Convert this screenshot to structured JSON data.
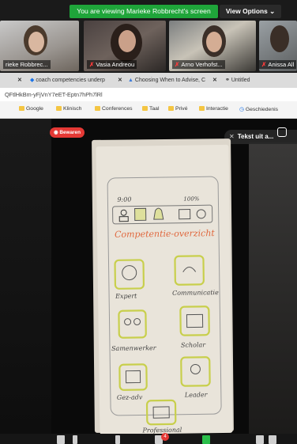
{
  "banner": {
    "viewing_text": "You are viewing Marieke Robbrecht's screen",
    "view_options_label": "View Options ⌄"
  },
  "participants": [
    {
      "name": "rieke Robbrec..."
    },
    {
      "name": "Vasia Andreou"
    },
    {
      "name": "Arno Verhofst..."
    },
    {
      "name": "Anissa All"
    }
  ],
  "browser": {
    "tabs": [
      {
        "label": "coach competencies underp"
      },
      {
        "label": "Choosing When to Advise, C"
      },
      {
        "label": "Untitled"
      }
    ],
    "address": "QFtlHkBm-yFjVnY7eET-Eptn7hPh7lRl",
    "bookmarks": [
      "Google",
      "Klinisch",
      "Conferences",
      "Taal",
      "Privé",
      "Interactie",
      "Geschiedenis"
    ]
  },
  "shared_view": {
    "bewaren_label": "Bewaren",
    "tekst_label": "Tekst uit a...",
    "sketch": {
      "status_left": "9:00",
      "status_right": "100%",
      "title": "Competentie-overzicht",
      "tiles": [
        {
          "label": "Expert"
        },
        {
          "label": "Communicatie"
        },
        {
          "label": "Samenwerker"
        },
        {
          "label": "Scholar"
        },
        {
          "label": "Gez-adv"
        },
        {
          "label": "Leader"
        },
        {
          "label": "Professional"
        }
      ]
    }
  },
  "toolbar": {
    "chat_badge": "4"
  },
  "colors": {
    "share_banner": "#1fa53a",
    "bewaren": "#e53935",
    "sketch_highlight": "#d6dc6a",
    "sketch_title": "#e0683e"
  }
}
